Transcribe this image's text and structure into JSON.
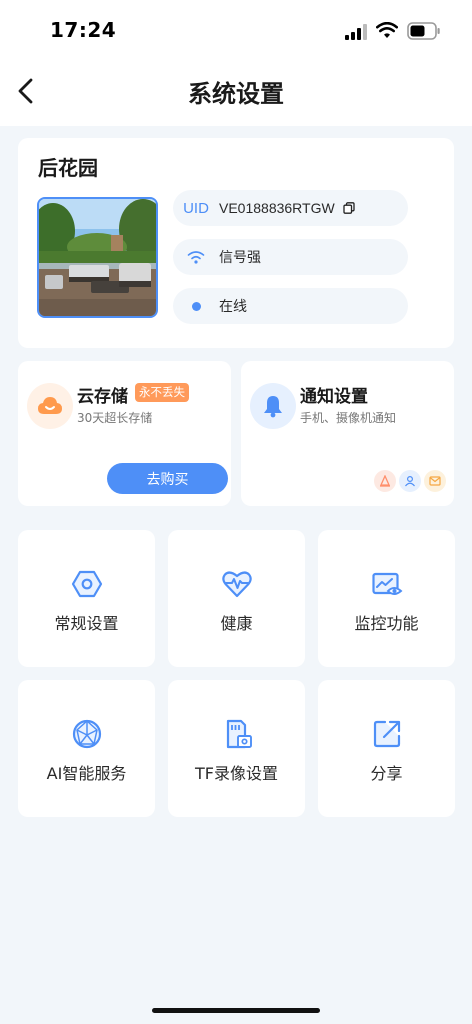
{
  "status_bar": {
    "time": "17:24"
  },
  "header": {
    "title": "系统设置"
  },
  "device": {
    "name": "后花园",
    "uid_label": "UID",
    "uid": "VE0188836RTGW",
    "signal": "信号强",
    "status": "在线"
  },
  "cloud": {
    "title": "云存储",
    "badge": "永不丢失",
    "subtitle": "30天超长存储",
    "button": "去购买"
  },
  "notify": {
    "title": "通知设置",
    "subtitle": "手机、摄像机通知"
  },
  "grid": {
    "general": "常规设置",
    "health": "健康",
    "monitor": "监控功能",
    "ai": "AI智能服务",
    "tf": "TF录像设置",
    "share": "分享"
  },
  "colors": {
    "accent": "#4e8ff7",
    "badge": "#ff9a5a",
    "background": "#f2f6fa"
  }
}
